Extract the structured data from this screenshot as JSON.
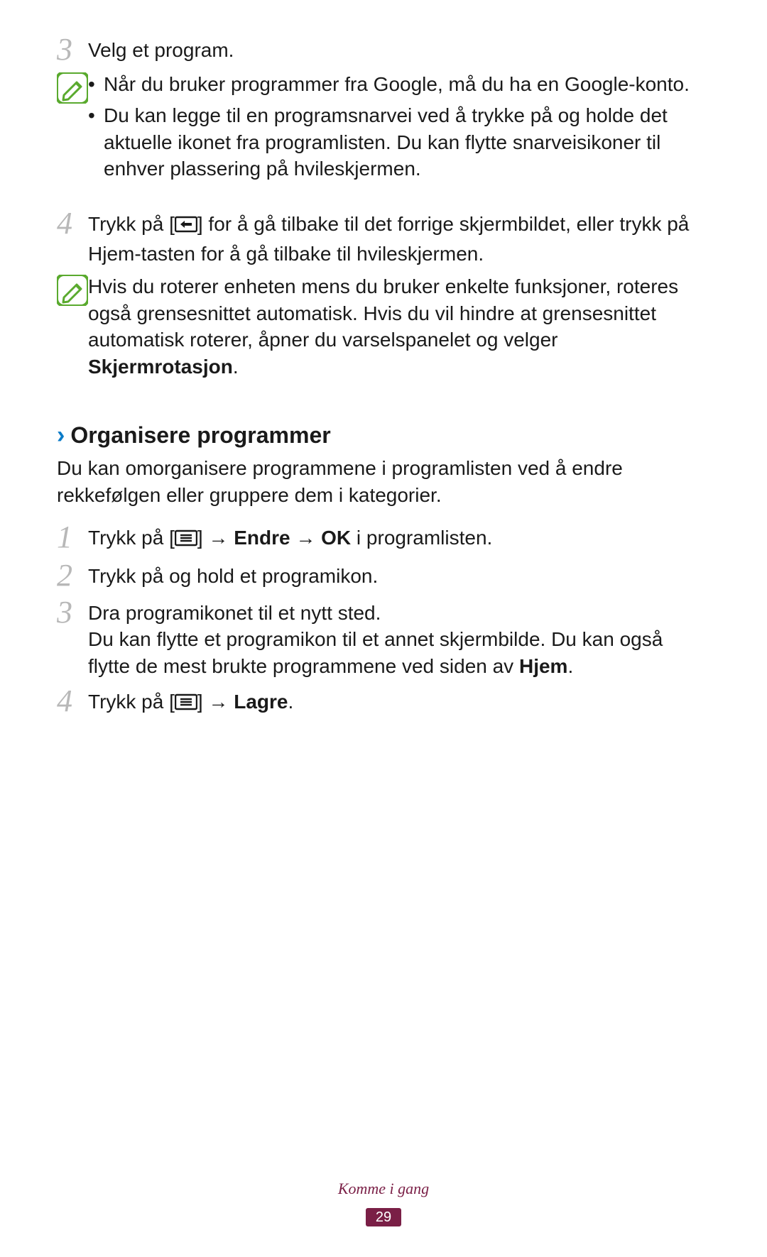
{
  "step3": {
    "num": "3",
    "text": "Velg et program."
  },
  "note1": {
    "b1": "Når du bruker programmer fra Google, må du ha en Google-konto.",
    "b2": "Du kan legge til en programsnarvei ved å trykke på og holde det aktuelle ikonet fra programlisten. Du kan flytte snarveisikoner til enhver plassering på hvileskjermen."
  },
  "step4": {
    "num": "4",
    "pre": "Trykk på [",
    "post": "] for å gå tilbake til det forrige skjermbildet, eller trykk på Hjem-tasten for å gå tilbake til hvileskjermen."
  },
  "note2": {
    "t1": "Hvis du roterer enheten mens du bruker enkelte funksjoner, roteres også grensesnittet automatisk. Hvis du vil hindre at grensesnittet automatisk roterer, åpner du varselspanelet og velger ",
    "bold": "Skjermrotasjon",
    "t2": "."
  },
  "heading": "Organisere programmer",
  "intro": "Du kan omorganisere programmene i programlisten ved å endre rekkefølgen eller gruppere dem i kategorier.",
  "org1": {
    "num": "1",
    "pre": "Trykk på [",
    "mid1": "] → ",
    "b1": "Endre",
    "mid2": " → ",
    "b2": "OK",
    "post": " i programlisten."
  },
  "org2": {
    "num": "2",
    "text": "Trykk på og hold et programikon."
  },
  "org3": {
    "num": "3",
    "l1": "Dra programikonet til et nytt sted.",
    "l2a": "Du kan flytte et programikon til et annet skjermbilde. Du kan også flytte de mest brukte programmene ved siden av ",
    "l2b": "Hjem",
    "l2c": "."
  },
  "org4": {
    "num": "4",
    "pre": "Trykk på [",
    "mid": "] → ",
    "b1": "Lagre",
    "post": "."
  },
  "footer": {
    "title": "Komme i gang",
    "page": "29"
  }
}
